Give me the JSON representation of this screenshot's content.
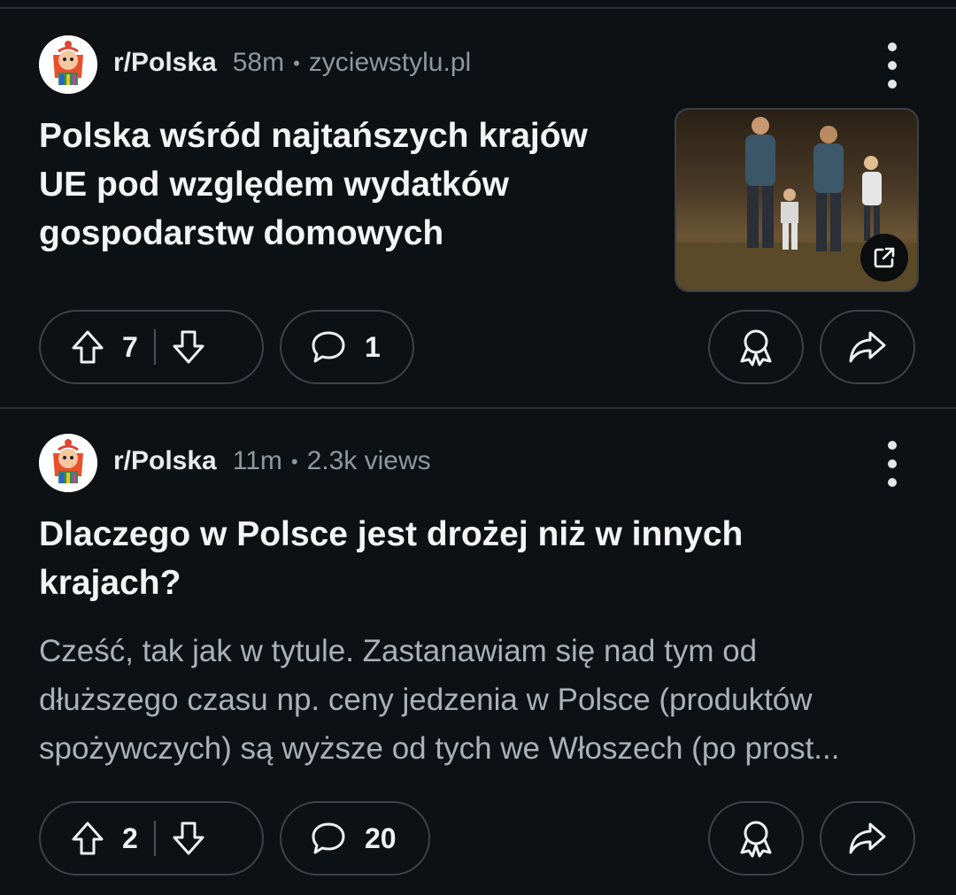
{
  "posts": [
    {
      "subreddit": "r/Polska",
      "age": "58m",
      "source": "zyciewstylu.pl",
      "title_lines": [
        "Polska wśród najtańszych krajów",
        "UE pod względem wydatków",
        "gospodarstw domowych"
      ],
      "upvotes": "7",
      "comments": "1",
      "has_thumbnail": true
    },
    {
      "subreddit": "r/Polska",
      "age": "11m",
      "source": "2.3k views",
      "title_lines": [
        "Dlaczego w Polsce jest drożej niż w innych",
        "krajach?"
      ],
      "body_lines": [
        "Cześć, tak jak w tytule. Zastanawiam się nad tym od",
        "dłuższego czasu np. ceny jedzenia w Polsce (produktów",
        "spożywczych) są wyższe od tych we Włoszech (po prost..."
      ],
      "upvotes": "2",
      "comments": "20"
    }
  ],
  "meta_separator": "•",
  "icons": {
    "upvote": "arrow-up-outline-icon",
    "downvote": "arrow-down-outline-icon",
    "comment": "speech-bubble-icon",
    "award": "award-ribbon-icon",
    "share": "share-arrow-icon",
    "more": "kebab-menu-icon",
    "external": "external-link-icon"
  },
  "colors": {
    "background": "#0e1113",
    "text": "#f2f2f2",
    "muted": "#8d98a0",
    "border": "#3c4247"
  }
}
